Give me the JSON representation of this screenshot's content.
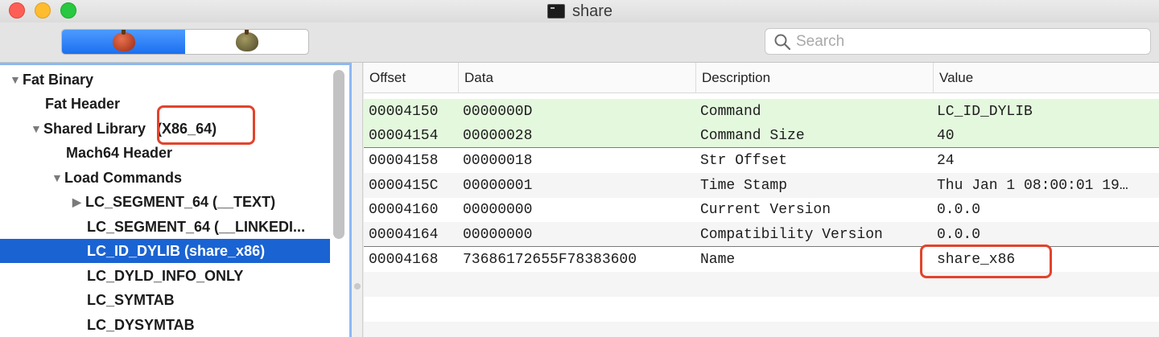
{
  "window": {
    "title": "share"
  },
  "toolbar": {
    "search_placeholder": "Search"
  },
  "tree": {
    "items": [
      {
        "label": "Fat Binary",
        "disclosure": "▼"
      },
      {
        "label": "Fat Header",
        "disclosure": ""
      },
      {
        "label": "Shared Library",
        "disclosure": "▼"
      },
      {
        "label": "(X86_64)",
        "disclosure": ""
      },
      {
        "label": "Mach64 Header",
        "disclosure": ""
      },
      {
        "label": "Load Commands",
        "disclosure": "▼"
      },
      {
        "label": "LC_SEGMENT_64 (__TEXT)",
        "disclosure": "▶"
      },
      {
        "label": "LC_SEGMENT_64 (__LINKEDI...",
        "disclosure": ""
      },
      {
        "label": "LC_ID_DYLIB (share_x86)",
        "disclosure": "",
        "selected": true
      },
      {
        "label": "LC_DYLD_INFO_ONLY",
        "disclosure": ""
      },
      {
        "label": "LC_SYMTAB",
        "disclosure": ""
      },
      {
        "label": "LC_DYSYMTAB",
        "disclosure": ""
      }
    ]
  },
  "table": {
    "columns": [
      "Offset",
      "Data",
      "Description",
      "Value"
    ],
    "rows": [
      [
        "00004150",
        "0000000D",
        "Command",
        "LC_ID_DYLIB"
      ],
      [
        "00004154",
        "00000028",
        "Command Size",
        "40"
      ],
      [
        "00004158",
        "00000018",
        "Str Offset",
        "24"
      ],
      [
        "0000415C",
        "00000001",
        "Time Stamp",
        "Thu Jan  1 08:00:01 19…"
      ],
      [
        "00004160",
        "00000000",
        "Current Version",
        "0.0.0"
      ],
      [
        "00004164",
        "00000000",
        "Compatibility Version",
        "0.0.0"
      ],
      [
        "00004168",
        "73686172655F78383600",
        "Name",
        "share_x86"
      ]
    ]
  },
  "colors": {
    "selection": "#1a63d3",
    "highlight_green": "#e4f8de",
    "annotation_red": "#e2432c",
    "segment_active": "#1c6ff0"
  },
  "icons": {
    "segment_left": "red-bug-icon",
    "segment_right": "olive-bug-icon",
    "search": "magnifier-icon"
  }
}
